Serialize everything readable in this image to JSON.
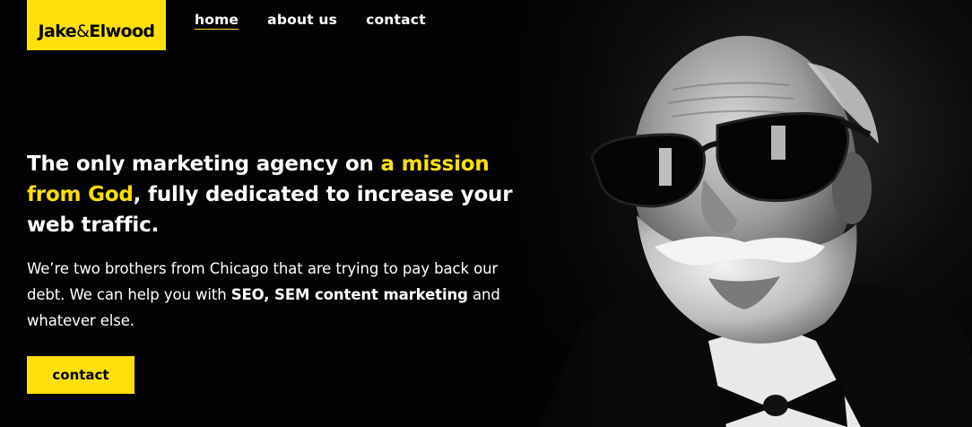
{
  "brand": {
    "logo_part1": "Jake",
    "logo_amp": "&",
    "logo_part2": "Elwood",
    "accent_color": "#ffe00a"
  },
  "nav": {
    "items": [
      {
        "label": "home",
        "active": true
      },
      {
        "label": "about us",
        "active": false
      },
      {
        "label": "contact",
        "active": false
      }
    ]
  },
  "hero": {
    "headline_part1": "The only marketing agency on ",
    "headline_highlight": "a mission from God",
    "headline_part2": ", fully dedicated to increase your web traffic.",
    "intro_part1": "We’re two brothers from Chicago that are trying to pay back our debt. We can help you with ",
    "intro_bold": "SEO, SEM content marketing",
    "intro_part2": " and whatever else.",
    "cta_label": "contact",
    "image_subject": "bearded-man-sunglasses-bowtie-portrait"
  }
}
